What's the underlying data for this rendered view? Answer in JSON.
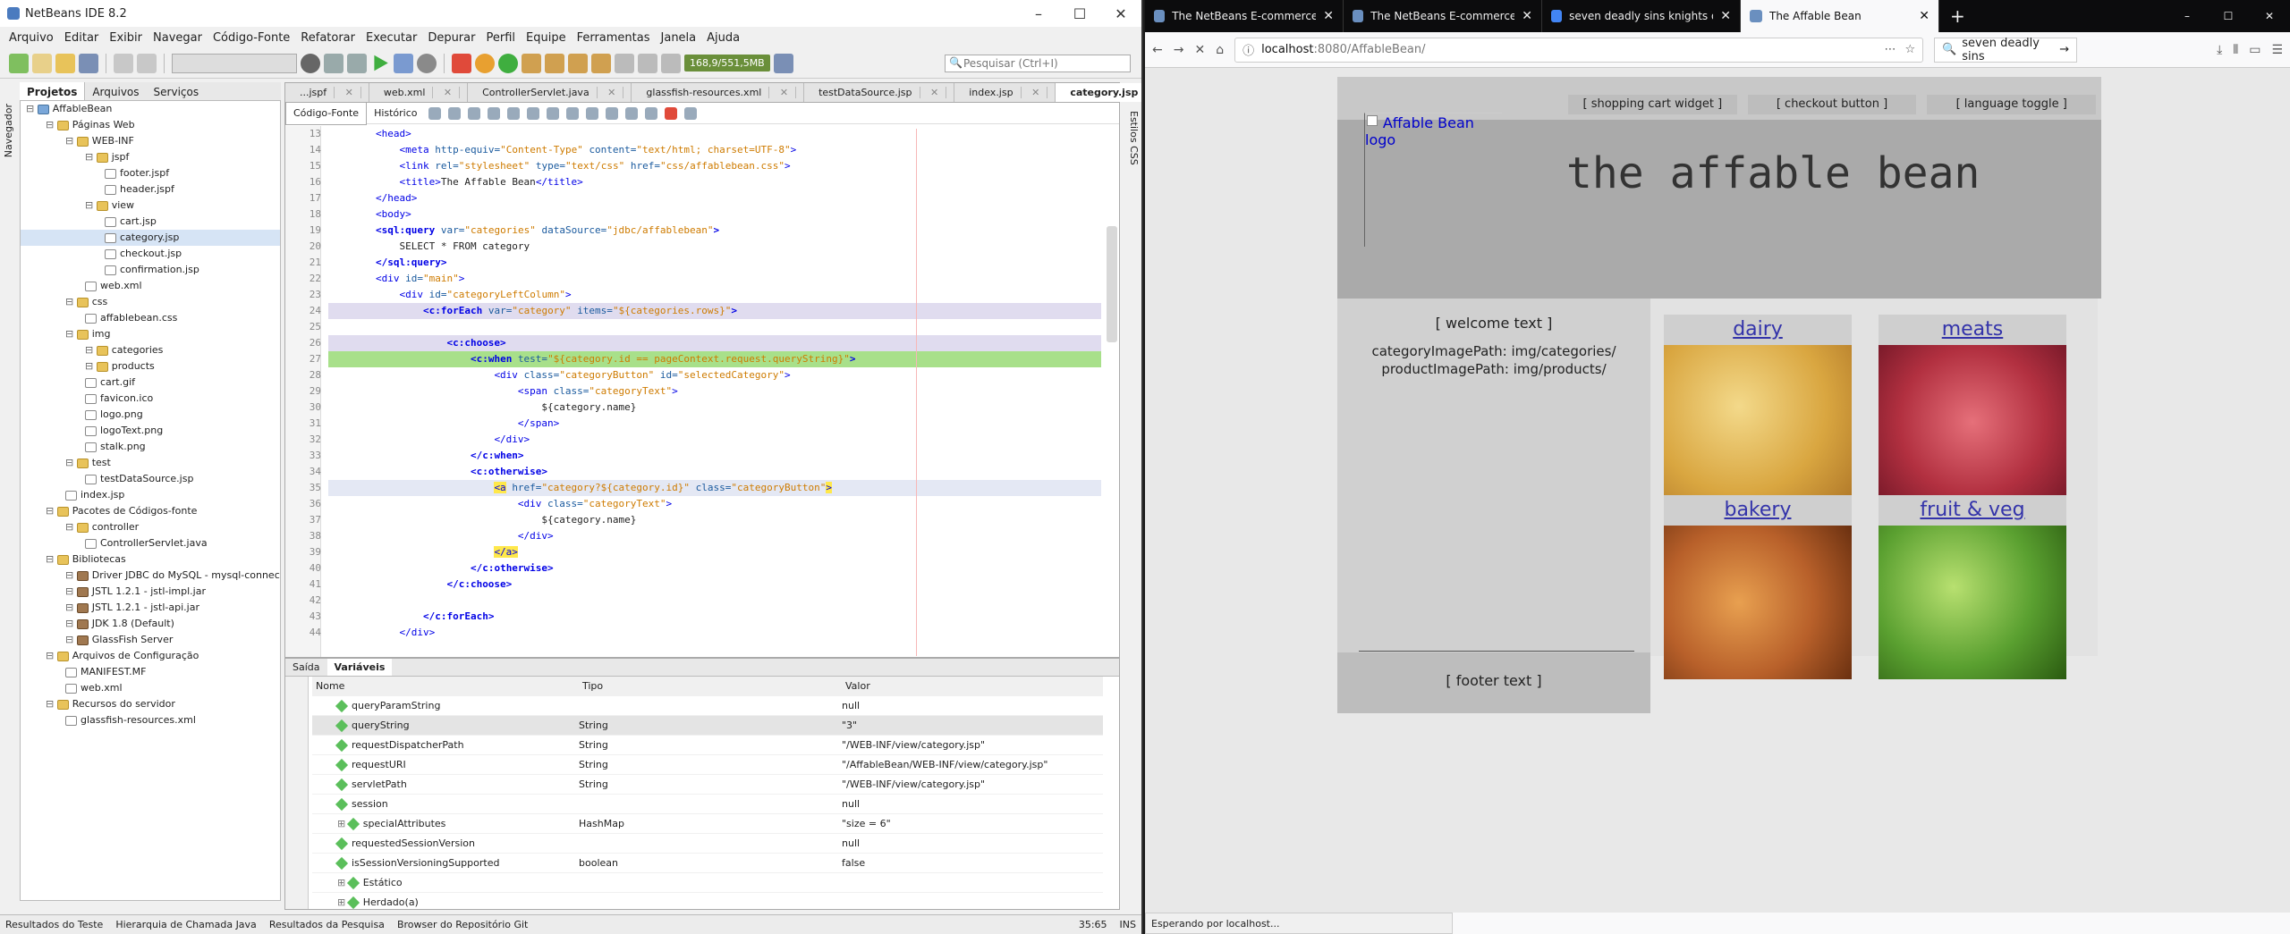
{
  "netbeans": {
    "title": "NetBeans IDE 8.2",
    "menu": [
      "Arquivo",
      "Editar",
      "Exibir",
      "Navegar",
      "Código-Fonte",
      "Refatorar",
      "Executar",
      "Depurar",
      "Perfil",
      "Equipe",
      "Ferramentas",
      "Janela",
      "Ajuda"
    ],
    "memory": "168,9/551,5MB",
    "search_placeholder": "Pesquisar (Ctrl+I)",
    "side_tabs": [
      "Projetos",
      "Arquivos",
      "Serviços"
    ],
    "navigator_label": "Navegador",
    "tree": [
      {
        "label": "AffableBean",
        "depth": 0,
        "kind": "proj"
      },
      {
        "label": "Páginas Web",
        "depth": 1,
        "kind": "folder"
      },
      {
        "label": "WEB-INF",
        "depth": 2,
        "kind": "folder"
      },
      {
        "label": "jspf",
        "depth": 3,
        "kind": "folder"
      },
      {
        "label": "footer.jspf",
        "depth": 4,
        "kind": "file"
      },
      {
        "label": "header.jspf",
        "depth": 4,
        "kind": "file"
      },
      {
        "label": "view",
        "depth": 3,
        "kind": "folder"
      },
      {
        "label": "cart.jsp",
        "depth": 4,
        "kind": "file"
      },
      {
        "label": "category.jsp",
        "depth": 4,
        "kind": "file",
        "selected": true
      },
      {
        "label": "checkout.jsp",
        "depth": 4,
        "kind": "file"
      },
      {
        "label": "confirmation.jsp",
        "depth": 4,
        "kind": "file"
      },
      {
        "label": "web.xml",
        "depth": 3,
        "kind": "file"
      },
      {
        "label": "css",
        "depth": 2,
        "kind": "folder"
      },
      {
        "label": "affablebean.css",
        "depth": 3,
        "kind": "file"
      },
      {
        "label": "img",
        "depth": 2,
        "kind": "folder"
      },
      {
        "label": "categories",
        "depth": 3,
        "kind": "folder"
      },
      {
        "label": "products",
        "depth": 3,
        "kind": "folder"
      },
      {
        "label": "cart.gif",
        "depth": 3,
        "kind": "file"
      },
      {
        "label": "favicon.ico",
        "depth": 3,
        "kind": "file"
      },
      {
        "label": "logo.png",
        "depth": 3,
        "kind": "file"
      },
      {
        "label": "logoText.png",
        "depth": 3,
        "kind": "file"
      },
      {
        "label": "stalk.png",
        "depth": 3,
        "kind": "file"
      },
      {
        "label": "test",
        "depth": 2,
        "kind": "folder"
      },
      {
        "label": "testDataSource.jsp",
        "depth": 3,
        "kind": "file"
      },
      {
        "label": "index.jsp",
        "depth": 2,
        "kind": "file"
      },
      {
        "label": "Pacotes de Códigos-fonte",
        "depth": 1,
        "kind": "folder"
      },
      {
        "label": "controller",
        "depth": 2,
        "kind": "folder"
      },
      {
        "label": "ControllerServlet.java",
        "depth": 3,
        "kind": "file"
      },
      {
        "label": "Bibliotecas",
        "depth": 1,
        "kind": "folder"
      },
      {
        "label": "Driver JDBC do MySQL - mysql-connector-j",
        "depth": 2,
        "kind": "lib"
      },
      {
        "label": "JSTL 1.2.1 - jstl-impl.jar",
        "depth": 2,
        "kind": "lib"
      },
      {
        "label": "JSTL 1.2.1 - jstl-api.jar",
        "depth": 2,
        "kind": "lib"
      },
      {
        "label": "JDK 1.8 (Default)",
        "depth": 2,
        "kind": "lib"
      },
      {
        "label": "GlassFish Server",
        "depth": 2,
        "kind": "lib"
      },
      {
        "label": "Arquivos de Configuração",
        "depth": 1,
        "kind": "folder"
      },
      {
        "label": "MANIFEST.MF",
        "depth": 2,
        "kind": "file"
      },
      {
        "label": "web.xml",
        "depth": 2,
        "kind": "file"
      },
      {
        "label": "Recursos do servidor",
        "depth": 1,
        "kind": "folder"
      },
      {
        "label": "glassfish-resources.xml",
        "depth": 2,
        "kind": "file"
      }
    ],
    "editor_tabs": [
      "...jspf",
      "web.xml",
      "ControllerServlet.java",
      "glassfish-resources.xml",
      "testDataSource.jsp",
      "index.jsp",
      "category.jsp"
    ],
    "editor_modes": [
      "Código-Fonte",
      "Histórico"
    ],
    "css_styles_label": "Estilos CSS",
    "code_lines": [
      {
        "n": "13",
        "html": "        <span class='t'>&lt;head&gt;</span>"
      },
      {
        "n": "14",
        "html": "            <span class='t'>&lt;meta</span> <span class='a'>http-equiv=</span><span class='s'>\"Content-Type\"</span> <span class='a'>content=</span><span class='s'>\"text/html; charset=UTF-8\"</span><span class='t'>&gt;</span>"
      },
      {
        "n": "15",
        "html": "            <span class='t'>&lt;link</span> <span class='a'>rel=</span><span class='s'>\"stylesheet\"</span> <span class='a'>type=</span><span class='s'>\"text/css\"</span> <span class='a'>href=</span><span class='s'>\"css/affablebean.css\"</span><span class='t'>&gt;</span>"
      },
      {
        "n": "16",
        "html": "            <span class='t'>&lt;title&gt;</span>The Affable Bean<span class='t'>&lt;/title&gt;</span>"
      },
      {
        "n": "17",
        "html": "        <span class='t'>&lt;/head&gt;</span>"
      },
      {
        "n": "18",
        "html": "        <span class='t'>&lt;body&gt;</span>"
      },
      {
        "n": "19",
        "html": "        <b class='t'>&lt;sql:query</b> <span class='a'>var=</span><span class='s'>\"categories\"</span> <span class='a'>dataSource=</span><span class='s'>\"jdbc/affablebean\"</span><b class='t'>&gt;</b>"
      },
      {
        "n": "20",
        "html": "            SELECT * FROM category"
      },
      {
        "n": "21",
        "html": "        <b class='t'>&lt;/sql:query&gt;</b>"
      },
      {
        "n": "22",
        "html": "        <span class='t'>&lt;div</span> <span class='a'>id=</span><span class='s'>\"main\"</span><span class='t'>&gt;</span>"
      },
      {
        "n": "23",
        "html": "            <span class='t'>&lt;div</span> <span class='a'>id=</span><span class='s'>\"categoryLeftColumn\"</span><span class='t'>&gt;</span>"
      },
      {
        "n": "24",
        "html": "                <b class='t'>&lt;c:forEach</b> <span class='a'>var=</span><span class='s'>\"category\"</span> <span class='a'>items=</span><span class='s'>\"${categories.rows}\"</span><b class='t'>&gt;</b>",
        "hl": "hlv"
      },
      {
        "n": "25",
        "html": "",
        "hl": ""
      },
      {
        "n": "26",
        "html": "                    <b class='t'>&lt;c:choose&gt;</b>",
        "hl": "hlv"
      },
      {
        "n": "27",
        "html": "                        <b class='t'>&lt;c:when</b> <span class='a'>test=</span><span class='s'>\"${category.id == pageContext.request.queryString}\"</span><b class='t'>&gt;</b>",
        "hl": "hlg"
      },
      {
        "n": "28",
        "html": "                            <span class='t'>&lt;div</span> <span class='a'>class=</span><span class='s'>\"categoryButton\"</span> <span class='a'>id=</span><span class='s'>\"selectedCategory\"</span><span class='t'>&gt;</span>"
      },
      {
        "n": "29",
        "html": "                                <span class='t'>&lt;span</span> <span class='a'>class=</span><span class='s'>\"categoryText\"</span><span class='t'>&gt;</span>"
      },
      {
        "n": "30",
        "html": "                                    ${category.name}"
      },
      {
        "n": "31",
        "html": "                                <span class='t'>&lt;/span&gt;</span>"
      },
      {
        "n": "32",
        "html": "                            <span class='t'>&lt;/div&gt;</span>"
      },
      {
        "n": "33",
        "html": "                        <b class='t'>&lt;/c:when&gt;</b>"
      },
      {
        "n": "34",
        "html": "                        <b class='t'>&lt;c:otherwise&gt;</b>"
      },
      {
        "n": "35",
        "html": "                            <span class='t yl'>&lt;a</span> <span class='a'>href=</span><span class='s'>\"category?${category.id}\"</span> <span class='a'>class=</span><span class='s'>\"categoryButton\"</span><span class='t yl'>&gt;</span>",
        "hl": "hlb"
      },
      {
        "n": "36",
        "html": "                                <span class='t'>&lt;div</span> <span class='a'>class=</span><span class='s'>\"categoryText\"</span><span class='t'>&gt;</span>"
      },
      {
        "n": "37",
        "html": "                                    ${category.name}"
      },
      {
        "n": "38",
        "html": "                                <span class='t'>&lt;/div&gt;</span>"
      },
      {
        "n": "39",
        "html": "                            <span class='t yl'>&lt;/a&gt;</span>"
      },
      {
        "n": "40",
        "html": "                        <b class='t'>&lt;/c:otherwise&gt;</b>"
      },
      {
        "n": "41",
        "html": "                    <b class='t'>&lt;/c:choose&gt;</b>"
      },
      {
        "n": "42",
        "html": ""
      },
      {
        "n": "43",
        "html": "                <b class='t'>&lt;/c:forEach&gt;</b>"
      },
      {
        "n": "44",
        "html": "            <span class='t'>&lt;/div&gt;</span>"
      }
    ],
    "bottom_tabs": [
      "Saída",
      "Variáveis"
    ],
    "var_headers": [
      "Nome",
      "Tipo",
      "Valor"
    ],
    "variables": [
      {
        "name": "queryParamString",
        "type": "",
        "value": "null"
      },
      {
        "name": "queryString",
        "type": "String",
        "value": "\"3\"",
        "selected": true
      },
      {
        "name": "requestDispatcherPath",
        "type": "String",
        "value": "\"/WEB-INF/view/category.jsp\""
      },
      {
        "name": "requestURI",
        "type": "String",
        "value": "\"/AffableBean/WEB-INF/view/category.jsp\""
      },
      {
        "name": "servletPath",
        "type": "String",
        "value": "\"/WEB-INF/view/category.jsp\""
      },
      {
        "name": "session",
        "type": "",
        "value": "null"
      },
      {
        "name": "specialAttributes",
        "type": "HashMap",
        "value": "\"size = 6\"",
        "expand": true
      },
      {
        "name": "requestedSessionVersion",
        "type": "",
        "value": "null"
      },
      {
        "name": "isSessionVersioningSupported",
        "type": "boolean",
        "value": "false"
      },
      {
        "name": "Estático",
        "type": "",
        "value": "",
        "expand": true
      },
      {
        "name": "Herdado(a)",
        "type": "",
        "value": "",
        "expand": true
      }
    ],
    "status": [
      "Resultados do Teste",
      "Hierarquia de Chamada Java",
      "Resultados da Pesquisa",
      "Browser do Repositório Git"
    ],
    "cursor": "35:65",
    "ins": "INS"
  },
  "firefox": {
    "tabs": [
      {
        "title": "The NetBeans E-commerce Tut"
      },
      {
        "title": "The NetBeans E-commerce Tut"
      },
      {
        "title": "seven deadly sins knights of br"
      },
      {
        "title": "The Affable Bean",
        "active": true
      }
    ],
    "url_host": "localhost",
    "url_rest": ":8080/AffableBean/",
    "search_value": "seven deadly sins",
    "status": "Esperando por localhost...",
    "page": {
      "logo_alt": "Affable Bean logo",
      "header_widgets": [
        "[ shopping cart widget ]",
        "[ checkout button ]",
        "[ language toggle ]"
      ],
      "logo_text": "the affable bean",
      "welcome": "[ welcome text ]",
      "category_image_path": "categoryImagePath: img/categories/",
      "product_image_path": "productImagePath: img/products/",
      "categories": [
        "dairy",
        "meats",
        "bakery",
        "fruit & veg"
      ],
      "footer": "[ footer text ]"
    }
  }
}
